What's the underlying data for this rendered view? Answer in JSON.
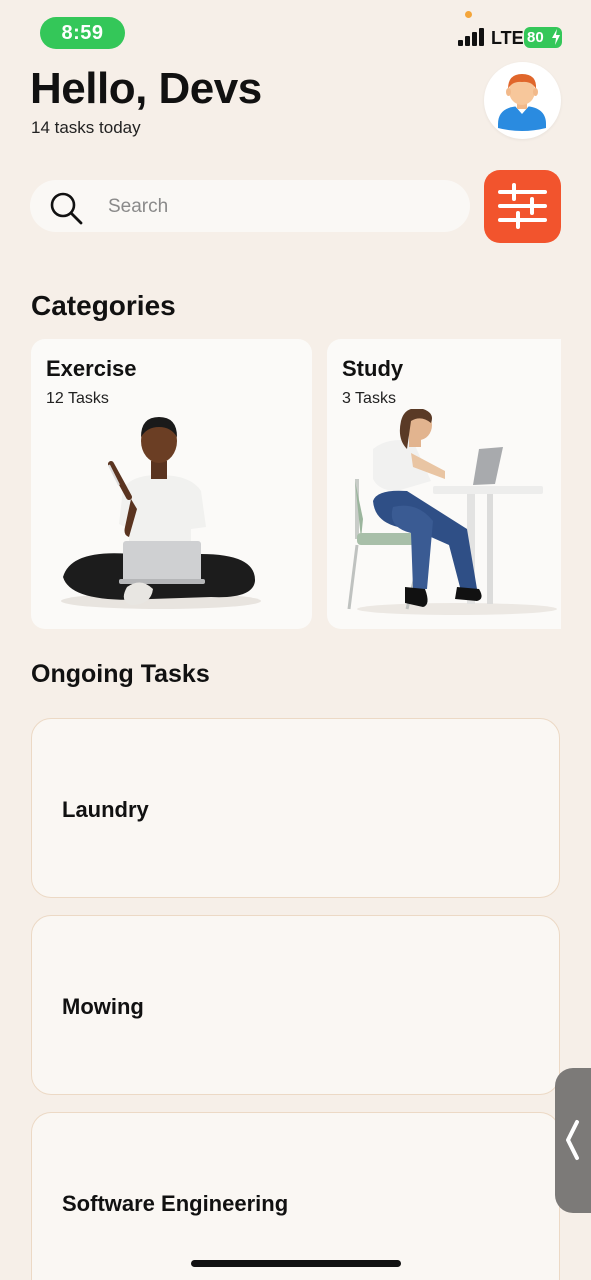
{
  "status": {
    "time": "8:59",
    "network": "LTE",
    "battery": "80"
  },
  "header": {
    "greeting": "Hello, Devs",
    "subtitle": "14 tasks today"
  },
  "search": {
    "placeholder": "Search"
  },
  "categories": {
    "title": "Categories",
    "items": [
      {
        "name": "Exercise",
        "count": "12 Tasks"
      },
      {
        "name": "Study",
        "count": "3 Tasks"
      }
    ]
  },
  "ongoing": {
    "title": "Ongoing Tasks",
    "items": [
      {
        "title": "Laundry"
      },
      {
        "title": "Mowing"
      },
      {
        "title": "Software Engineering"
      }
    ]
  },
  "colors": {
    "accent": "#f2542d",
    "background": "#f6efe8",
    "status_green": "#34c759"
  },
  "icons": [
    "search-icon",
    "filter-icon",
    "avatar-icon",
    "chevron-left-icon",
    "signal-icon",
    "battery-icon"
  ]
}
